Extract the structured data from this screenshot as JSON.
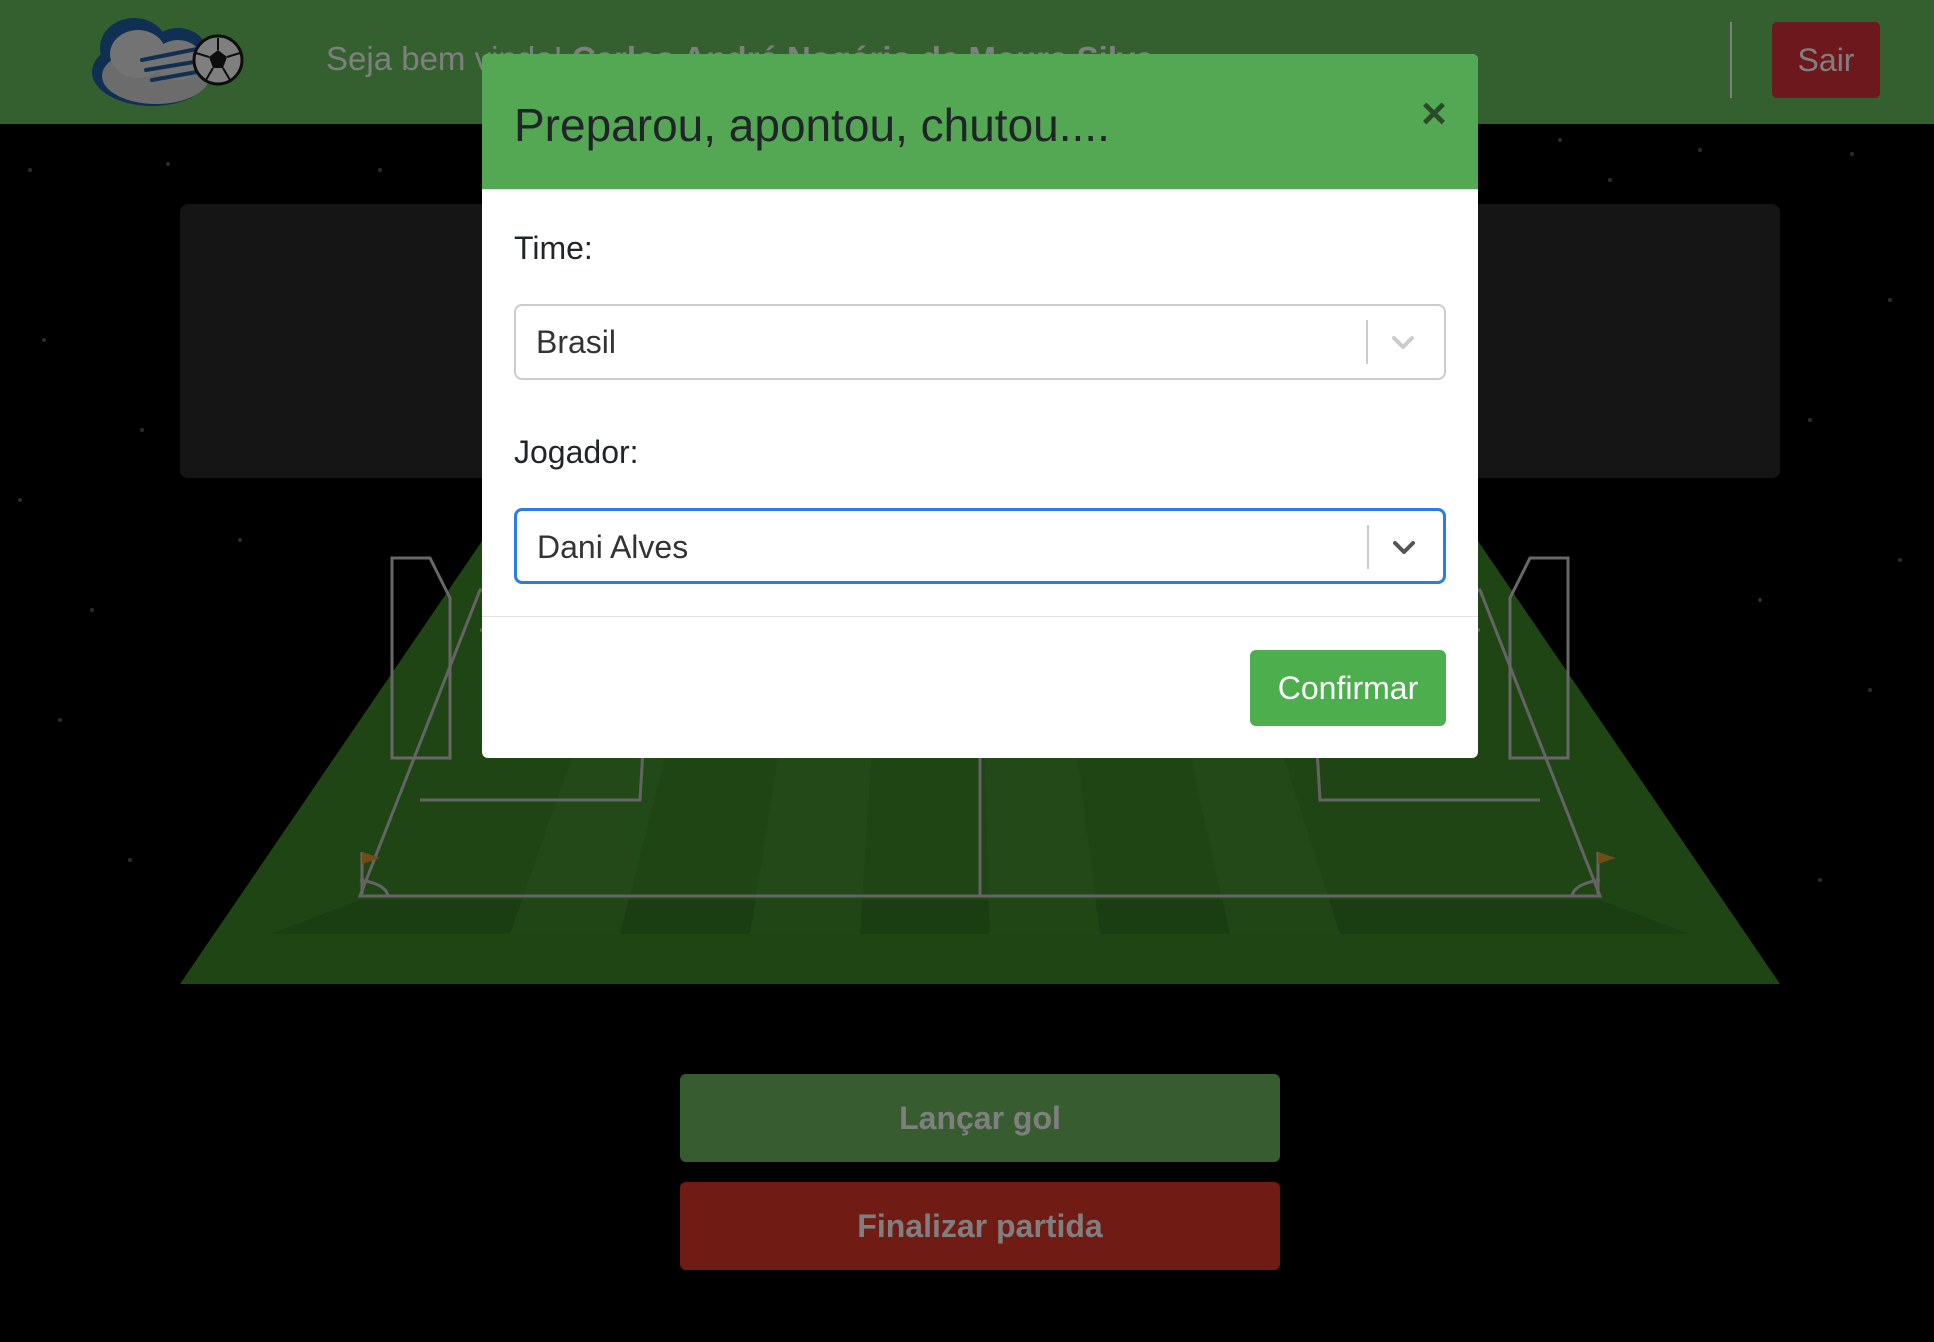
{
  "header": {
    "welcome_prefix": "Seja bem vindo! ",
    "user_name": "Carlos André Nogário de Moura Silva",
    "logout_label": "Sair"
  },
  "actions": {
    "launch_goal_label": "Lançar gol",
    "end_match_label": "Finalizar partida"
  },
  "modal": {
    "title": "Preparou, apontou, chutou....",
    "close_symbol": "×",
    "team_label": "Time:",
    "team_value": "Brasil",
    "player_label": "Jogador:",
    "player_value": "Dani Alves",
    "confirm_label": "Confirmar"
  },
  "colors": {
    "navbar": "#68c05f",
    "modal_header": "#54a854",
    "confirm": "#4cae4c",
    "logout": "#d9303a",
    "end_match": "#e0392b",
    "focus_border": "#2a7de1"
  }
}
